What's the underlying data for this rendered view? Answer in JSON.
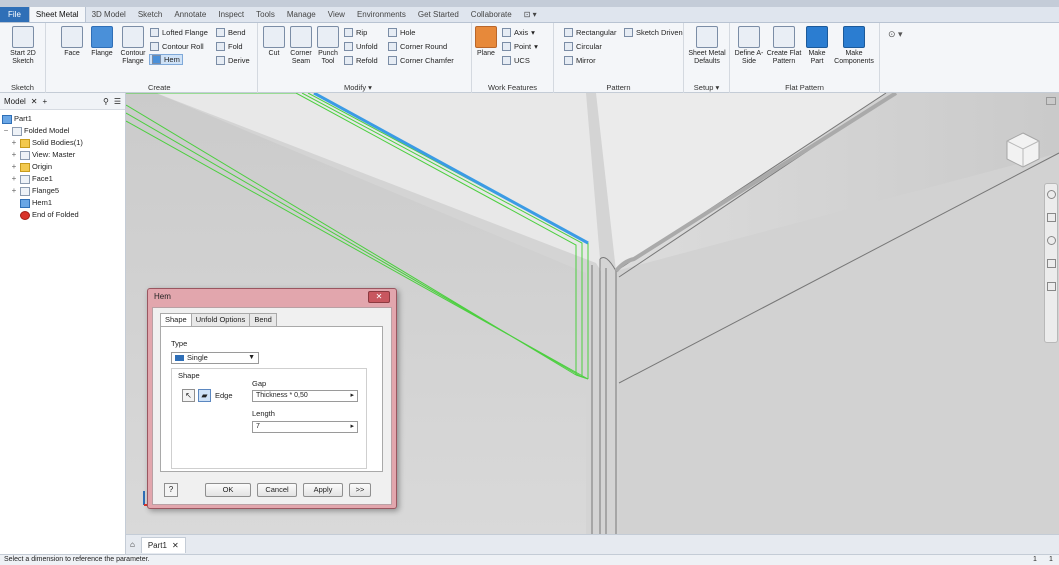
{
  "ribbon": {
    "tabs": [
      "File",
      "Sheet Metal",
      "3D Model",
      "Sketch",
      "Annotate",
      "Inspect",
      "Tools",
      "Manage",
      "View",
      "Environments",
      "Get Started",
      "Collaborate"
    ],
    "active_tab": "Sheet Metal",
    "panels": {
      "sketch": {
        "title": "Sketch",
        "start_sketch": "Start 2D Sketch"
      },
      "create": {
        "title": "Create",
        "face": "Face",
        "flange": "Flange",
        "contour_flange": "Contour Flange",
        "lofted_flange": "Lofted Flange",
        "contour_roll": "Contour Roll",
        "hem": "Hem",
        "bend": "Bend",
        "fold": "Fold",
        "derive": "Derive"
      },
      "modify": {
        "title": "Modify",
        "cut": "Cut",
        "corner_seam": "Corner Seam",
        "punch_tool": "Punch Tool",
        "rip": "Rip",
        "unfold": "Unfold",
        "refold": "Refold",
        "hole": "Hole",
        "corner_round": "Corner Round",
        "corner_chamfer": "Corner Chamfer"
      },
      "work_features": {
        "title": "Work Features",
        "plane": "Plane",
        "axis": "Axis",
        "point": "Point",
        "ucs": "UCS"
      },
      "pattern": {
        "title": "Pattern",
        "rectangular": "Rectangular",
        "circular": "Circular",
        "mirror": "Mirror",
        "sketch_driven": "Sketch Driven"
      },
      "setup": {
        "title": "Setup",
        "sheet_metal_defaults": "Sheet Metal Defaults"
      },
      "flat_pattern": {
        "title": "Flat Pattern",
        "define_a_side": "Define A-Side",
        "create_flat_pattern": "Create Flat Pattern",
        "make_part": "Make Part",
        "make_components": "Make Components"
      }
    }
  },
  "browser": {
    "tab_label": "Model",
    "tree": [
      {
        "label": "Part1",
        "level": 0,
        "icon": "part-icon",
        "expander": ""
      },
      {
        "label": "Folded Model",
        "level": 0,
        "icon": "folded-model-icon",
        "expander": "−"
      },
      {
        "label": "Solid Bodies(1)",
        "level": 1,
        "icon": "folder-icon",
        "expander": "+"
      },
      {
        "label": "View: Master",
        "level": 1,
        "icon": "view-icon",
        "expander": "+"
      },
      {
        "label": "Origin",
        "level": 1,
        "icon": "folder-icon",
        "expander": "+"
      },
      {
        "label": "Face1",
        "level": 1,
        "icon": "face-icon",
        "expander": "+"
      },
      {
        "label": "Flange5",
        "level": 1,
        "icon": "flange-icon",
        "expander": "+"
      },
      {
        "label": "Hem1",
        "level": 1,
        "icon": "hem-icon",
        "expander": ""
      },
      {
        "label": "End of Folded",
        "level": 1,
        "icon": "end-of-folded-icon",
        "expander": ""
      }
    ]
  },
  "dialog": {
    "title": "Hem",
    "tabs": [
      "Shape",
      "Unfold Options",
      "Bend"
    ],
    "active_tab": "Shape",
    "type_label": "Type",
    "type_value": "Single",
    "shape_group": "Shape",
    "edge_label": "Edge",
    "gap_label": "Gap",
    "gap_value": "Thickness * 0,50",
    "length_label": "Length",
    "length_value": "7",
    "buttons": {
      "ok": "OK",
      "cancel": "Cancel",
      "apply": "Apply",
      "more": ">>"
    }
  },
  "document_tabs": {
    "home": "⌂",
    "active": "Part1"
  },
  "status": {
    "message": "Select a dimension to reference the parameter.",
    "count1": "1",
    "count2": "1"
  },
  "colors": {
    "accent": "#2f6fb7",
    "selection_green": "#4ccf3f",
    "edge_blue": "#3b9be5",
    "dialog_frame": "#e2a6ad"
  }
}
